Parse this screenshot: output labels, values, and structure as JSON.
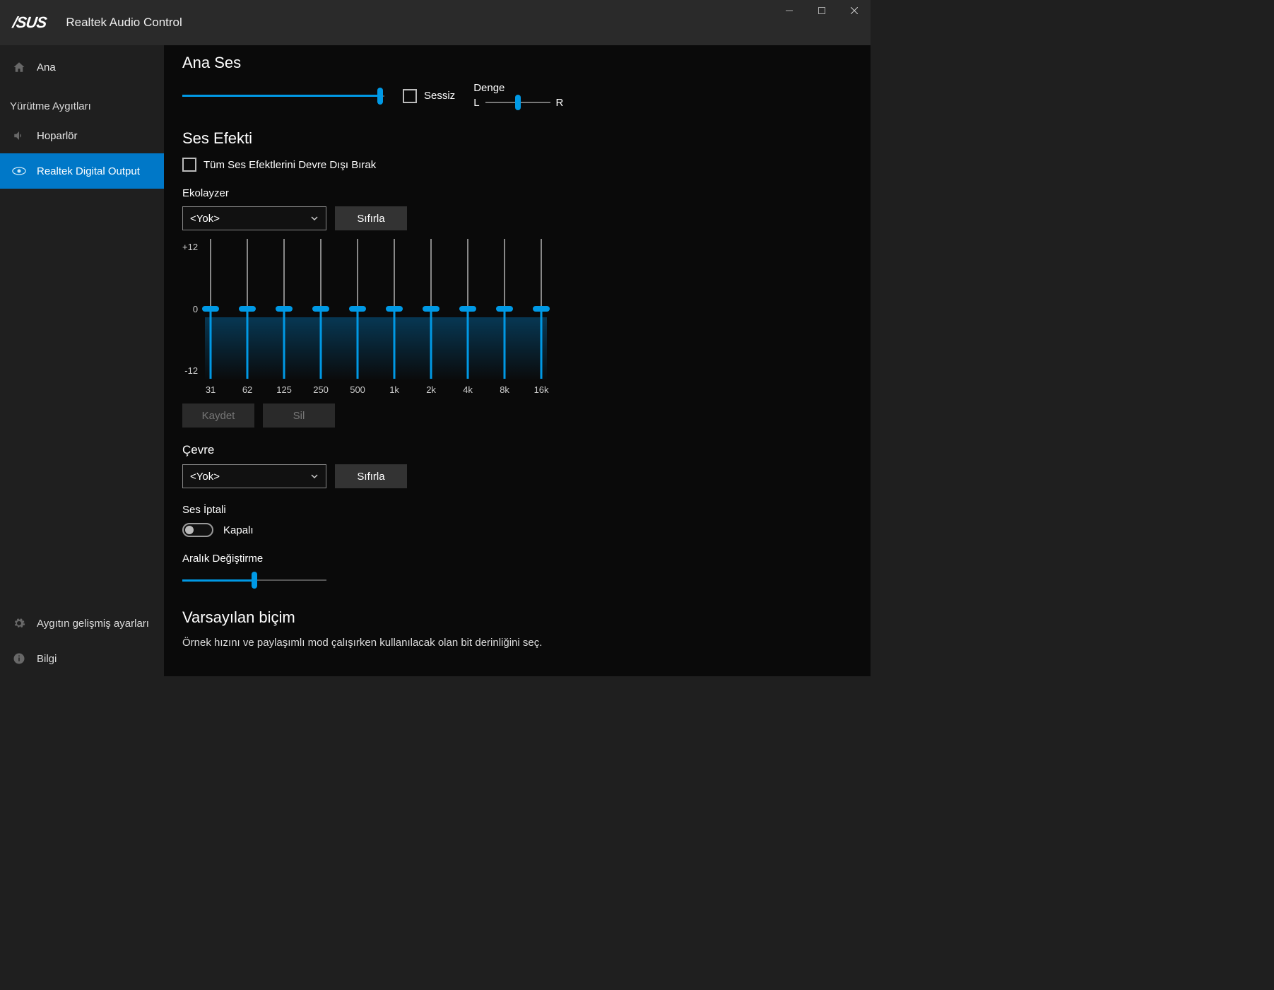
{
  "app": {
    "logo": "/SUS",
    "title": "Realtek Audio Control"
  },
  "sidebar": {
    "home_label": "Ana",
    "devices_header": "Yürütme Aygıtları",
    "speaker_label": "Hoparlör",
    "digital_out_label": "Realtek Digital Output",
    "advanced_label": "Aygıtın gelişmiş ayarları",
    "info_label": "Bilgi"
  },
  "main": {
    "main_sound_title": "Ana Ses",
    "mute_label": "Sessiz",
    "balance_title": "Denge",
    "balance_left": "L",
    "balance_right": "R",
    "effect_title": "Ses Efekti",
    "disable_all_label": "Tüm Ses Efektlerini Devre Dışı Bırak",
    "equalizer_title": "Ekolayzer",
    "eq_select_value": "<Yok>",
    "reset_label": "Sıfırla",
    "eq_y_top": "+12",
    "eq_y_mid": "0",
    "eq_y_bot": "-12",
    "eq_bands": [
      "31",
      "62",
      "125",
      "250",
      "500",
      "1k",
      "2k",
      "4k",
      "8k",
      "16k"
    ],
    "save_label": "Kaydet",
    "delete_label": "Sil",
    "env_title": "Çevre",
    "env_select_value": "<Yok>",
    "env_reset_label": "Sıfırla",
    "voice_cancel_title": "Ses İptali",
    "voice_cancel_value": "Kapalı",
    "pitch_title": "Aralık Değiştirme",
    "default_format_title": "Varsayılan biçim",
    "default_format_desc": "Örnek hızını ve paylaşımlı mod çalışırken kullanılacak olan bit derinliğini seç."
  },
  "chart_data": {
    "type": "equalizer",
    "frequencies": [
      "31",
      "62",
      "125",
      "250",
      "500",
      "1k",
      "2k",
      "4k",
      "8k",
      "16k"
    ],
    "values": [
      0,
      0,
      0,
      0,
      0,
      0,
      0,
      0,
      0,
      0
    ],
    "ylim": [
      -12,
      12
    ]
  }
}
